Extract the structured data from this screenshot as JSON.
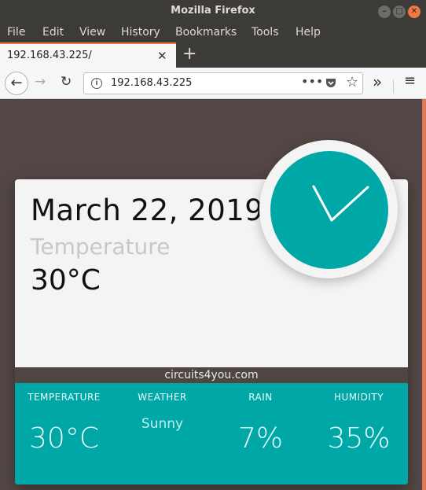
{
  "window": {
    "title": "Mozilla Firefox"
  },
  "menubar": {
    "items": [
      "File",
      "Edit",
      "View",
      "History",
      "Bookmarks",
      "Tools",
      "Help"
    ]
  },
  "tab": {
    "title": "192.168.43.225/"
  },
  "urlbar": {
    "url": "192.168.43.225"
  },
  "page": {
    "date": "March 22, 2019",
    "temperature_label": "Temperature",
    "temperature_value": "30°C",
    "brand": "circuits4you.com",
    "stats": [
      {
        "label": "TEMPERATURE",
        "value": "30°C"
      },
      {
        "label": "WEATHER",
        "value": "Sunny"
      },
      {
        "label": "RAIN",
        "value": "7%"
      },
      {
        "label": "HUMIDITY",
        "value": "35%"
      }
    ],
    "colors": {
      "accent": "#00a7a7",
      "background": "#524744",
      "card": "#f4f4f4"
    }
  },
  "icons": {
    "window_controls": [
      "minimize-icon",
      "maximize-icon",
      "close-icon"
    ],
    "nav": [
      "back-icon",
      "forward-icon",
      "reload-icon",
      "info-icon",
      "page-actions-icon",
      "pocket-icon",
      "bookmark-star-icon",
      "overflow-icon",
      "hamburger-menu-icon"
    ]
  }
}
